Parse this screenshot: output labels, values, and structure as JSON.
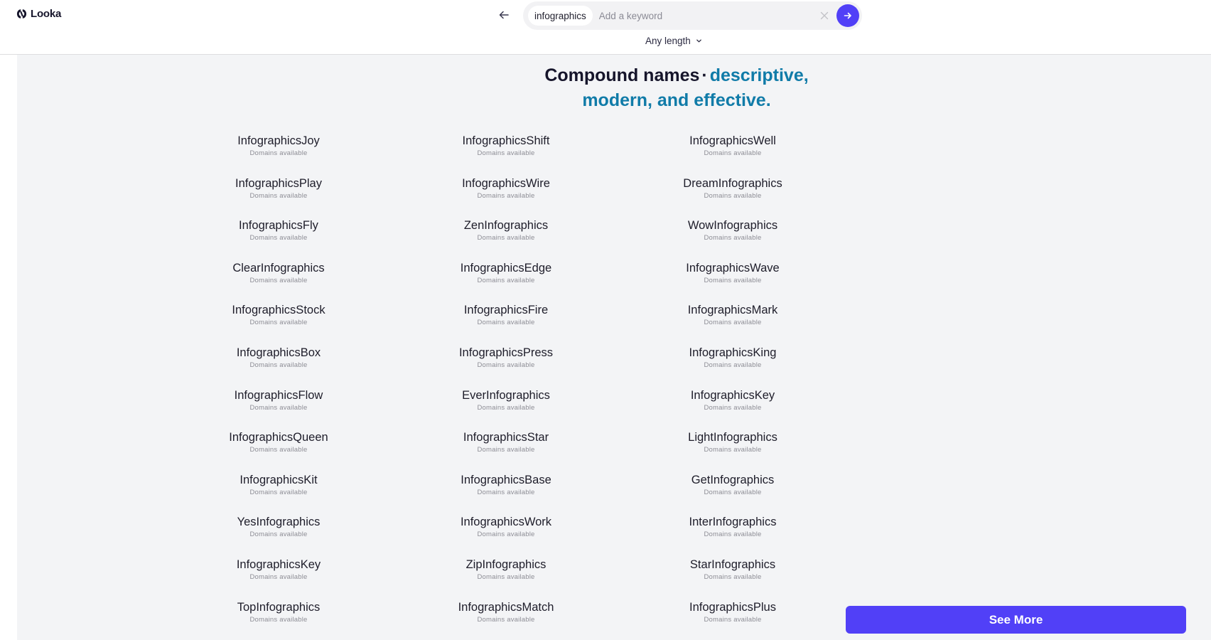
{
  "header": {
    "brand": "Looka",
    "search": {
      "chip": "infographics",
      "placeholder": "Add a keyword",
      "value": ""
    },
    "length_filter": "Any length"
  },
  "main": {
    "heading": {
      "primary": "Compound names",
      "separator": "·",
      "accent_line1": "descriptive,",
      "accent_line2": "modern, and effective."
    },
    "columns": [
      [
        {
          "name": "InfographicsJoy",
          "status": "Domains available"
        },
        {
          "name": "InfographicsPlay",
          "status": "Domains available"
        },
        {
          "name": "InfographicsFly",
          "status": "Domains available"
        },
        {
          "name": "ClearInfographics",
          "status": "Domains available"
        },
        {
          "name": "InfographicsStock",
          "status": "Domains available"
        },
        {
          "name": "InfographicsBox",
          "status": "Domains available"
        },
        {
          "name": "InfographicsFlow",
          "status": "Domains available"
        },
        {
          "name": "InfographicsQueen",
          "status": "Domains available"
        },
        {
          "name": "InfographicsKit",
          "status": "Domains available"
        },
        {
          "name": "YesInfographics",
          "status": "Domains available"
        },
        {
          "name": "InfographicsKey",
          "status": "Domains available"
        },
        {
          "name": "TopInfographics",
          "status": "Domains available"
        }
      ],
      [
        {
          "name": "InfographicsShift",
          "status": "Domains available"
        },
        {
          "name": "InfographicsWire",
          "status": "Domains available"
        },
        {
          "name": "ZenInfographics",
          "status": "Domains available"
        },
        {
          "name": "InfographicsEdge",
          "status": "Domains available"
        },
        {
          "name": "InfographicsFire",
          "status": "Domains available"
        },
        {
          "name": "InfographicsPress",
          "status": "Domains available"
        },
        {
          "name": "EverInfographics",
          "status": "Domains available"
        },
        {
          "name": "InfographicsStar",
          "status": "Domains available"
        },
        {
          "name": "InfographicsBase",
          "status": "Domains available"
        },
        {
          "name": "InfographicsWork",
          "status": "Domains available"
        },
        {
          "name": "ZipInfographics",
          "status": "Domains available"
        },
        {
          "name": "InfographicsMatch",
          "status": "Domains available"
        }
      ],
      [
        {
          "name": "InfographicsWell",
          "status": "Domains available"
        },
        {
          "name": "DreamInfographics",
          "status": "Domains available"
        },
        {
          "name": "WowInfographics",
          "status": "Domains available"
        },
        {
          "name": "InfographicsWave",
          "status": "Domains available"
        },
        {
          "name": "InfographicsMark",
          "status": "Domains available"
        },
        {
          "name": "InfographicsKing",
          "status": "Domains available"
        },
        {
          "name": "InfographicsKey",
          "status": "Domains available"
        },
        {
          "name": "LightInfographics",
          "status": "Domains available"
        },
        {
          "name": "GetInfographics",
          "status": "Domains available"
        },
        {
          "name": "InterInfographics",
          "status": "Domains available"
        },
        {
          "name": "StarInfographics",
          "status": "Domains available"
        },
        {
          "name": "InfographicsPlus",
          "status": "Domains available"
        }
      ]
    ],
    "see_more_label": "See More"
  },
  "colors": {
    "brand_primary": "#5140f7",
    "heading_accent": "#107ba8",
    "page_background": "#f3f4f6"
  }
}
